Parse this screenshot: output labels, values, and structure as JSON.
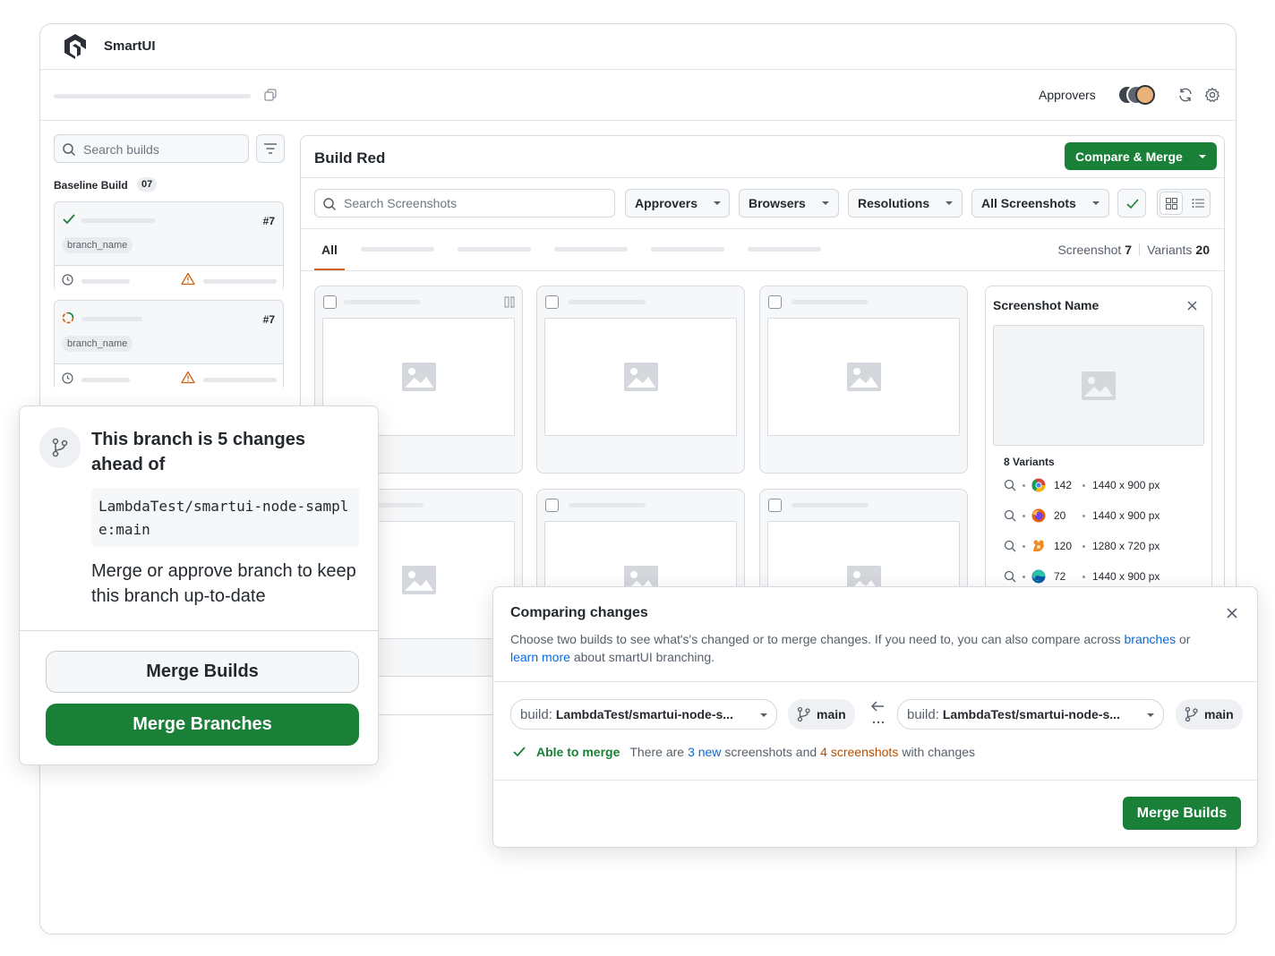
{
  "app": {
    "name": "SmartUI",
    "approvers_label": "Approvers"
  },
  "sidebar": {
    "search_placeholder": "Search builds",
    "baseline_label": "Baseline Build",
    "baseline_count": "07",
    "builds": [
      {
        "status": "passed",
        "number": "#7",
        "branch": "branch_name"
      },
      {
        "status": "running",
        "number": "#7",
        "branch": "branch_name"
      }
    ]
  },
  "main": {
    "title": "Build Red",
    "compare_merge_label": "Compare & Merge",
    "search_placeholder": "Search Screenshots",
    "filters": [
      "Approvers",
      "Browsers",
      "Resolutions",
      "All Screenshots"
    ],
    "tab_all": "All",
    "screenshot_label": "Screenshot",
    "screenshot_count": "7",
    "variants_label": "Variants",
    "variants_count": "20"
  },
  "detail": {
    "title": "Screenshot Name",
    "variants_heading": "8 Variants",
    "variants": [
      {
        "browser": "chrome-icon",
        "count": "142",
        "resolution": "1440 x 900 px"
      },
      {
        "browser": "firefox-icon",
        "count": "20",
        "resolution": "1440 x 900 px"
      },
      {
        "browser": "safari-icon",
        "count": "120",
        "resolution": "1280 x 720 px"
      },
      {
        "browser": "edge-icon",
        "count": "72",
        "resolution": "1440 x 900 px"
      }
    ]
  },
  "branch_popover": {
    "heading": "This branch is 5 changes ahead of",
    "repo": "LambdaTest/smartui-node-sample:main",
    "message": "Merge or approve branch to keep this branch up-to-date",
    "merge_builds_label": "Merge Builds",
    "merge_branches_label": "Merge Branches"
  },
  "compare_dialog": {
    "title": "Comparing changes",
    "desc_prefix": "Choose two builds to see what's's changed or to merge changes. If you need to, you can also compare across",
    "desc_link1": "branches",
    "desc_or": "or",
    "desc_link2": "learn more",
    "desc_suffix": "about smartUI branching.",
    "left_build_prefix": "build:",
    "left_build_value": "LambdaTest/smartui-node-s...",
    "left_branch": "main",
    "right_build_prefix": "build:",
    "right_build_value": "LambdaTest/smartui-node-s...",
    "right_branch": "main",
    "able_label": "Able to merge",
    "status_pre": "There are",
    "status_new": "3 new",
    "status_mid": "screenshots and",
    "status_changed": "4 screenshots",
    "status_post": "with changes",
    "merge_button": "Merge Builds"
  },
  "colors": {
    "primary_green": "#1a7f37",
    "link_blue": "#0969da",
    "warning_orange": "#bc4c00"
  }
}
